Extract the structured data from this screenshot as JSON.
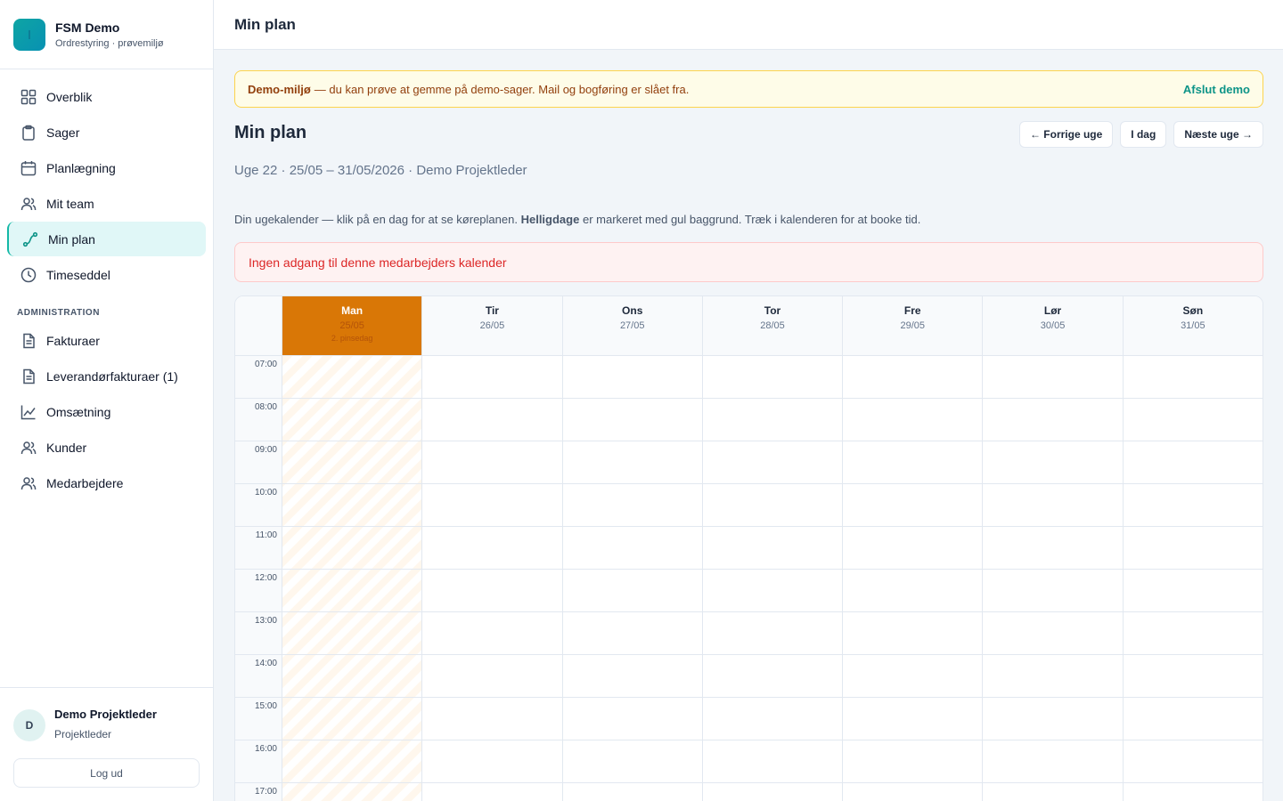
{
  "brand": {
    "name": "FSM Demo",
    "subtitle": "Ordrestyring · prøvemiljø"
  },
  "sidebar": {
    "items": [
      {
        "label": "Overblik",
        "icon": "grid-icon"
      },
      {
        "label": "Sager",
        "icon": "clipboard-icon"
      },
      {
        "label": "Planlægning",
        "icon": "calendar-icon"
      },
      {
        "label": "Mit team",
        "icon": "users-icon"
      },
      {
        "label": "Min plan",
        "icon": "route-icon",
        "active": true
      },
      {
        "label": "Timeseddel",
        "icon": "clock-icon"
      }
    ],
    "admin_heading": "ADMINISTRATION",
    "admin_items": [
      {
        "label": "Fakturaer",
        "icon": "document-icon"
      },
      {
        "label": "Leverandørfakturaer (1)",
        "icon": "document-icon"
      },
      {
        "label": "Omsætning",
        "icon": "chart-icon"
      },
      {
        "label": "Kunder",
        "icon": "users-icon"
      },
      {
        "label": "Medarbejdere",
        "icon": "users-icon"
      }
    ]
  },
  "user": {
    "initial": "D",
    "name": "Demo Projektleder",
    "role": "Projektleder",
    "logout_label": "Log ud"
  },
  "topbar": {
    "title": "Min plan"
  },
  "banner": {
    "bold": "Demo-miljø",
    "text": "— du kan prøve at gemme på demo-sager. Mail og bogføring er slået fra.",
    "action": "Afslut demo"
  },
  "page": {
    "title": "Min plan",
    "subtitle": "Uge 22 · 25/05 – 31/05/2026 · Demo Projektleder",
    "desc_before": "Din ugekalender — klik på en dag for at se køreplanen.",
    "desc_bold": "Helligdage",
    "desc_after": "er markeret med gul baggrund. Træk i kalenderen for at booke tid.",
    "error": "Ingen adgang til denne medarbejders kalender"
  },
  "week_nav": {
    "prev": "← Forrige uge",
    "today": "I dag",
    "next": "Næste uge →"
  },
  "calendar": {
    "days": [
      {
        "name": "Man",
        "date": "25/05",
        "holiday": "2. pinsedag"
      },
      {
        "name": "Tir",
        "date": "26/05"
      },
      {
        "name": "Ons",
        "date": "27/05"
      },
      {
        "name": "Tor",
        "date": "28/05"
      },
      {
        "name": "Fre",
        "date": "29/05"
      },
      {
        "name": "Lør",
        "date": "30/05"
      },
      {
        "name": "Søn",
        "date": "31/05"
      }
    ],
    "times": [
      "07:00",
      "08:00",
      "09:00",
      "10:00",
      "11:00",
      "12:00",
      "13:00",
      "14:00",
      "15:00",
      "16:00",
      "17:00"
    ],
    "colors": {
      "holiday_header": "#d97706",
      "accent": "#0d9488"
    }
  }
}
